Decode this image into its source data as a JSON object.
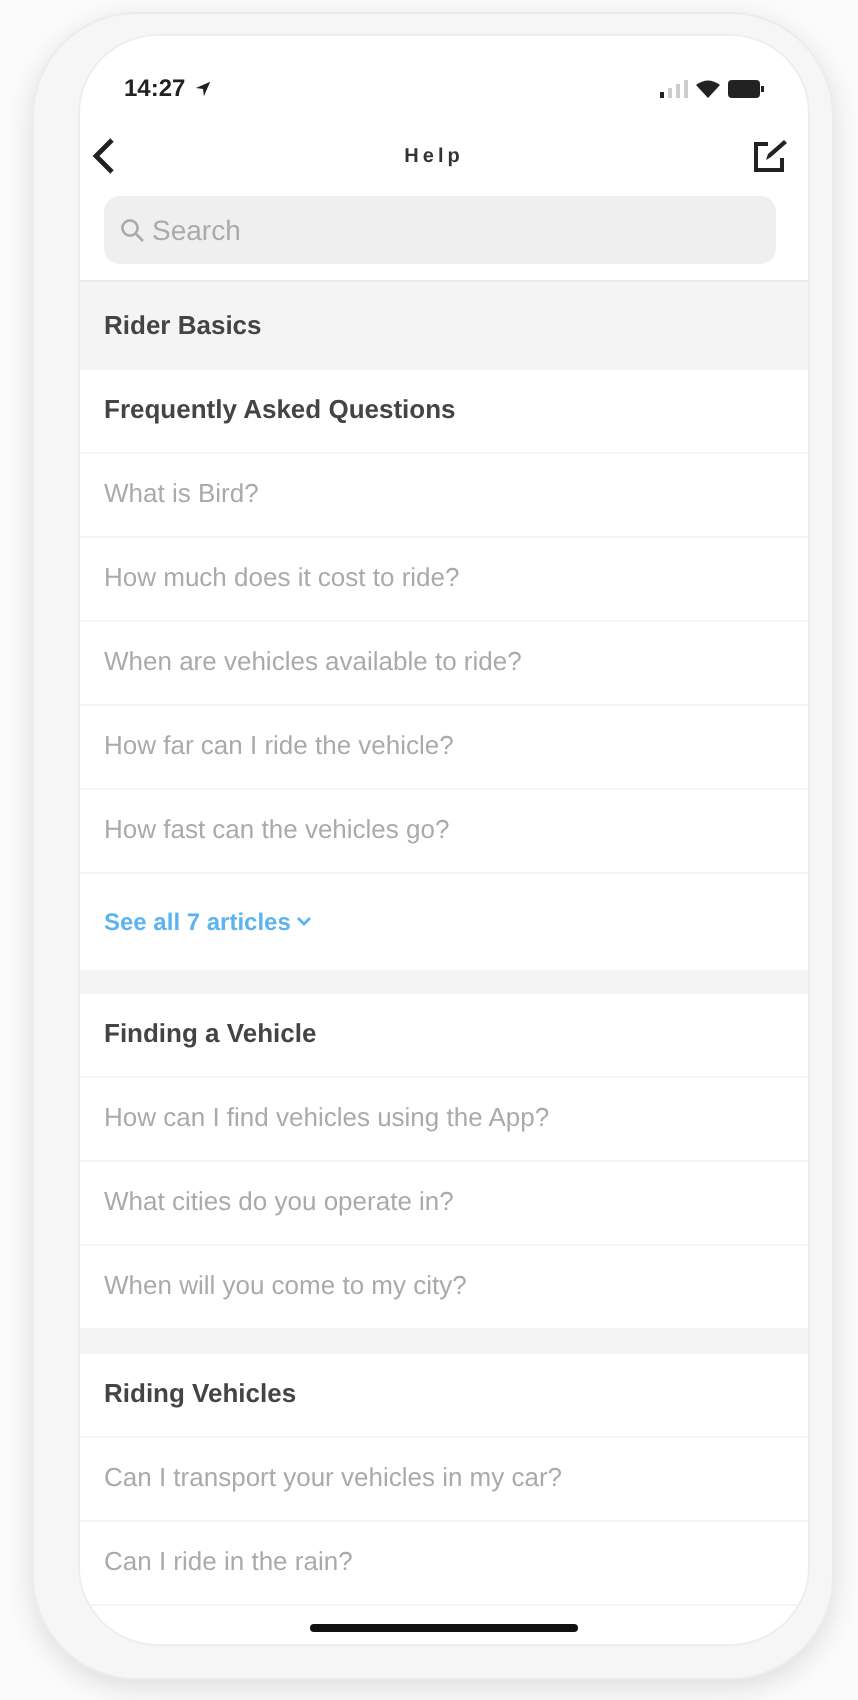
{
  "status_bar": {
    "time": "14:27"
  },
  "nav": {
    "title": "Help"
  },
  "search": {
    "placeholder": "Search"
  },
  "category": "Rider Basics",
  "sections": [
    {
      "title": "Frequently Asked Questions",
      "articles": [
        "What is Bird?",
        "How much does it cost to ride?",
        "When are vehicles available to ride?",
        "How far can I ride the vehicle?",
        "How fast can the vehicles go?"
      ],
      "see_all": "See all 7 articles"
    },
    {
      "title": "Finding a Vehicle",
      "articles": [
        "How can I find vehicles using the App?",
        "What cities do you operate in?",
        "When will you come to my city?"
      ]
    },
    {
      "title": "Riding Vehicles",
      "articles": [
        "Can I transport your vehicles in my car?",
        "Can I ride in the rain?"
      ]
    }
  ]
}
